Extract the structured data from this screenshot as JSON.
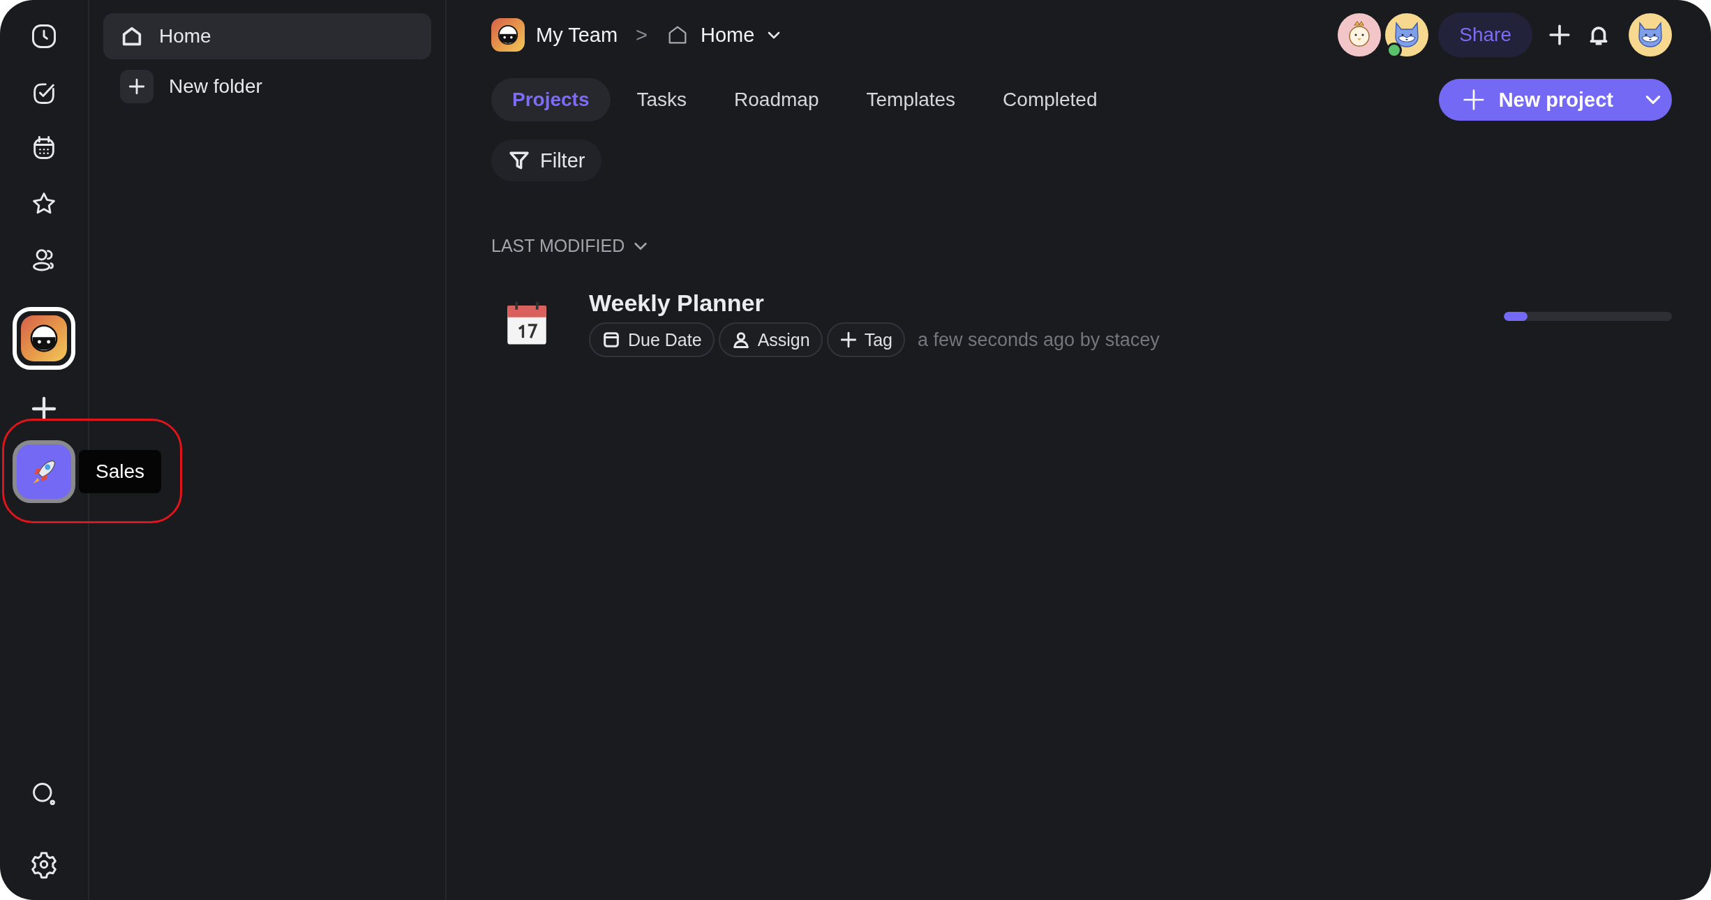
{
  "rail": {
    "workspaces": [
      {
        "kind": "team",
        "selected": true
      },
      {
        "kind": "rocket",
        "selected": false,
        "tooltip": "Sales"
      }
    ]
  },
  "sidebar": {
    "items": [
      {
        "kind": "page",
        "label": "Home",
        "selected": true
      },
      {
        "kind": "add",
        "label": "New folder",
        "selected": false
      }
    ]
  },
  "breadcrumb": {
    "team": "My Team",
    "separator": ">",
    "page": "Home"
  },
  "members": [
    {
      "kind": "chick",
      "online": false
    },
    {
      "kind": "fox",
      "online": true
    }
  ],
  "share": "Share",
  "tabs": [
    {
      "label": "Projects",
      "selected": true
    },
    {
      "label": "Tasks",
      "selected": false
    },
    {
      "label": "Roadmap",
      "selected": false
    },
    {
      "label": "Templates",
      "selected": false
    },
    {
      "label": "Completed",
      "selected": false
    }
  ],
  "new_project": "New project",
  "filter": "Filter",
  "sort": "LAST MODIFIED",
  "projects": [
    {
      "title": "Weekly Planner",
      "chips": [
        {
          "kind": "date",
          "label": "Due Date"
        },
        {
          "kind": "assign",
          "label": "Assign"
        },
        {
          "kind": "tag",
          "label": "Tag"
        }
      ],
      "meta": "a few seconds ago by stacey",
      "level": 0.14
    }
  ]
}
